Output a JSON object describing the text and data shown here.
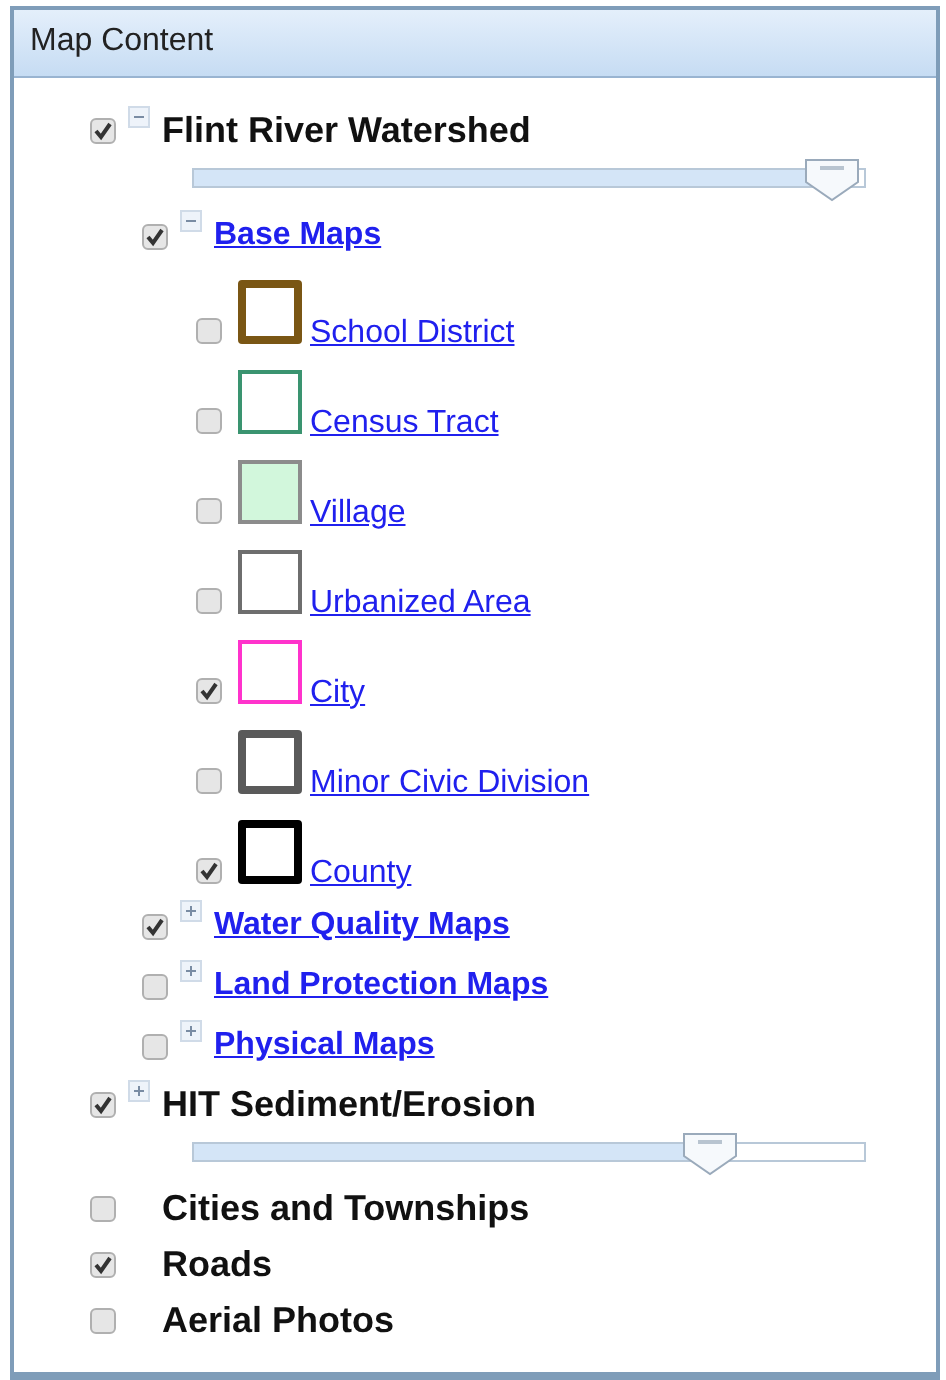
{
  "panel": {
    "title": "Map Content"
  },
  "layers": [
    {
      "label": "Flint River Watershed",
      "checked": true,
      "expanded": true,
      "level": 0.95,
      "children": [
        {
          "label": "Base Maps",
          "checked": true,
          "expanded": true,
          "children": [
            {
              "label": "School District",
              "checked": false,
              "color": "#7a5614",
              "kind": "thick"
            },
            {
              "label": "Census Tract",
              "checked": false,
              "color": "#3a9470",
              "kind": "thin"
            },
            {
              "label": "Village",
              "checked": false,
              "color": "#d2f7dc",
              "kind": "filled"
            },
            {
              "label": "Urbanized Area",
              "checked": false,
              "color": "#6e6e6e",
              "kind": "thin"
            },
            {
              "label": "City",
              "checked": true,
              "color": "#ff33cc",
              "kind": "thin"
            },
            {
              "label": "Minor Civic Division",
              "checked": false,
              "color": "#5a5a5a",
              "kind": "thick"
            },
            {
              "label": "County",
              "checked": true,
              "color": "#000000",
              "kind": "thick"
            }
          ]
        },
        {
          "label": "Water Quality Maps",
          "checked": true,
          "expanded": false
        },
        {
          "label": "Land Protection Maps",
          "checked": false,
          "expanded": false
        },
        {
          "label": "Physical Maps",
          "checked": false,
          "expanded": false
        }
      ]
    },
    {
      "label": "HIT Sediment/Erosion",
      "checked": true,
      "expanded": false,
      "level": 0.77
    },
    {
      "label": "Cities and Townships",
      "checked": false
    },
    {
      "label": "Roads",
      "checked": true
    },
    {
      "label": "Aerial Photos",
      "checked": false
    }
  ]
}
